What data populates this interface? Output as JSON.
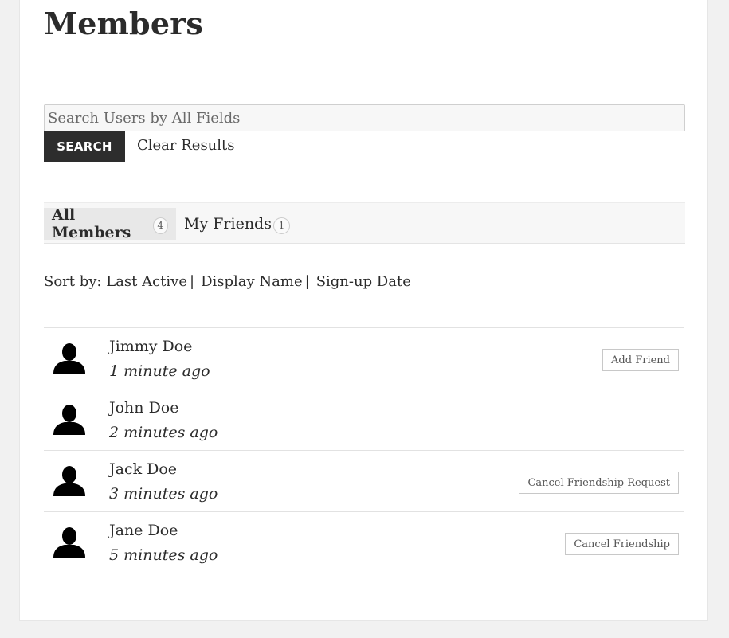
{
  "page": {
    "title": "Members"
  },
  "search": {
    "placeholder": "Search Users by All Fields",
    "value": "",
    "button_label": "SEARCH",
    "clear_label": "Clear Results"
  },
  "tabs": [
    {
      "label": "All Members",
      "count": "4",
      "active": true
    },
    {
      "label": "My Friends",
      "count": "1",
      "active": false
    }
  ],
  "sort": {
    "label": "Sort by:",
    "options": [
      "Last Active",
      "Display Name",
      "Sign-up Date"
    ],
    "separator": "|"
  },
  "members": [
    {
      "name": "Jimmy Doe",
      "last_active": "1 minute ago",
      "action": "Add Friend"
    },
    {
      "name": "John Doe",
      "last_active": "2 minutes ago",
      "action": ""
    },
    {
      "name": "Jack Doe",
      "last_active": "3 minutes ago",
      "action": "Cancel Friendship Request"
    },
    {
      "name": "Jane Doe",
      "last_active": "5 minutes ago",
      "action": "Cancel Friendship"
    }
  ],
  "icons": {
    "avatar": "user-silhouette-icon"
  },
  "colors": {
    "search_button_bg": "#2d2d2d",
    "tabs_bar_bg": "#f7f7f7",
    "active_tab_bg": "#e8e8e8",
    "page_bg": "#f1f1f1"
  }
}
